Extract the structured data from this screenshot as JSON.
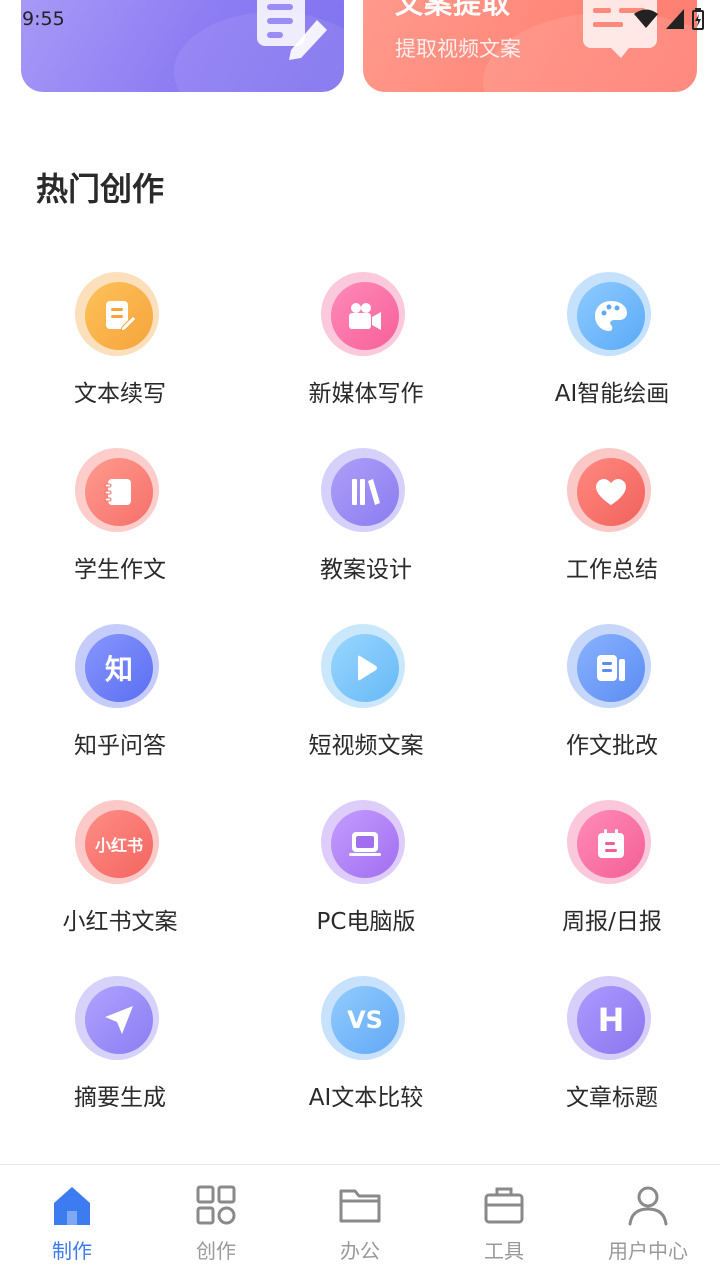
{
  "status_bar": {
    "time": "9:55"
  },
  "banners": [
    {
      "title": "",
      "subtitle": ""
    },
    {
      "title": "文案提取",
      "subtitle": "提取视频文案"
    }
  ],
  "section_title": "热门创作",
  "grid_items": [
    {
      "label": "文本续写",
      "icon": "document-edit-icon",
      "color": "#f5a43c"
    },
    {
      "label": "新媒体写作",
      "icon": "video-camera-icon",
      "color": "#f7609a"
    },
    {
      "label": "AI智能绘画",
      "icon": "palette-icon",
      "color": "#5aaaf7"
    },
    {
      "label": "学生作文",
      "icon": "notebook-icon",
      "color": "#f5706a"
    },
    {
      "label": "教案设计",
      "icon": "books-icon",
      "color": "#8a7cf0"
    },
    {
      "label": "工作总结",
      "icon": "heart-icon",
      "color": "#f2615c"
    },
    {
      "label": "知乎问答",
      "icon": "zhihu-icon",
      "color": "#5b6ef0"
    },
    {
      "label": "短视频文案",
      "icon": "play-icon",
      "color": "#66b9f6"
    },
    {
      "label": "作文批改",
      "icon": "article-icon",
      "color": "#5b8cf2"
    },
    {
      "label": "小红书文案",
      "icon": "xiaohongshu-icon",
      "color": "#f46560"
    },
    {
      "label": "PC电脑版",
      "icon": "laptop-icon",
      "color": "#a16ef0"
    },
    {
      "label": "周报/日报",
      "icon": "calendar-icon",
      "color": "#f45f95"
    },
    {
      "label": "摘要生成",
      "icon": "send-icon",
      "color": "#8b7df2"
    },
    {
      "label": "AI文本比较",
      "icon": "vs-icon",
      "color": "#62a8f6"
    },
    {
      "label": "文章标题",
      "icon": "h-letter-icon",
      "color": "#8b74ef"
    }
  ],
  "grid_icon_texts": {
    "zhihu": "知",
    "xiaohongshu": "小红书",
    "vs": "VS",
    "h": "H"
  },
  "bottom_nav": [
    {
      "label": "制作",
      "icon": "home-icon",
      "active": true
    },
    {
      "label": "创作",
      "icon": "grid-icon",
      "active": false
    },
    {
      "label": "办公",
      "icon": "folder-icon",
      "active": false
    },
    {
      "label": "工具",
      "icon": "briefcase-icon",
      "active": false
    },
    {
      "label": "用户中心",
      "icon": "user-icon",
      "active": false
    }
  ],
  "colors": {
    "accent": "#3d7bf0",
    "inactive": "#9a9a9a"
  }
}
